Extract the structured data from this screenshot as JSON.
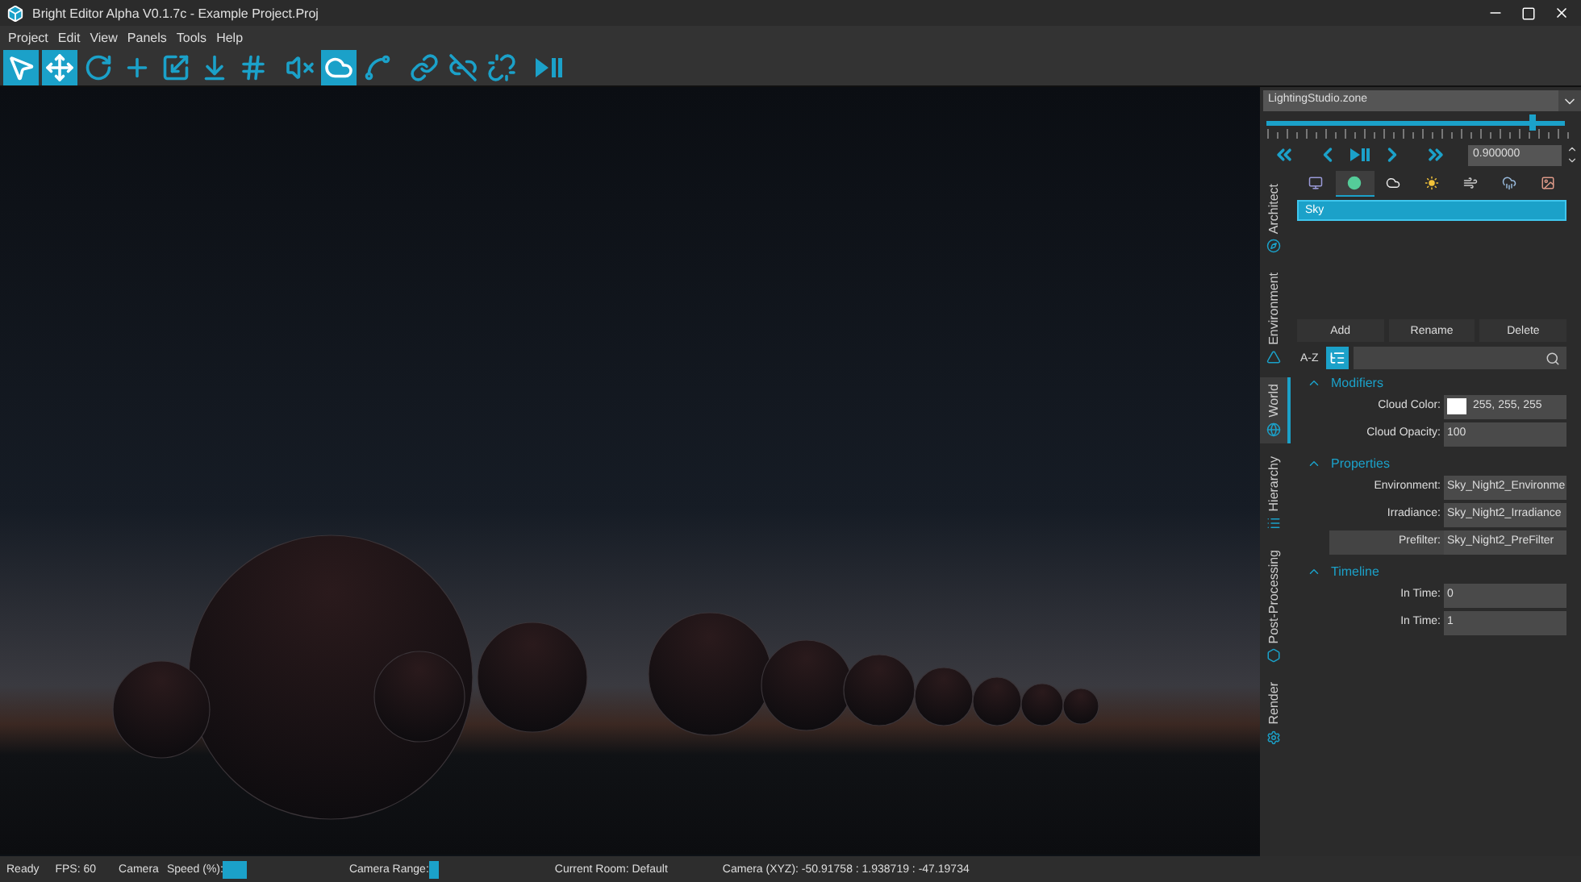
{
  "window": {
    "title": "Bright Editor Alpha V0.1.7c - Example Project.Proj"
  },
  "menu": [
    "Project",
    "Edit",
    "View",
    "Panels",
    "Tools",
    "Help"
  ],
  "toolbar": [
    {
      "kind": "pointer",
      "selected": true
    },
    {
      "kind": "move",
      "selected": true
    },
    {
      "kind": "rotate",
      "selected": false
    },
    {
      "kind": "cross",
      "selected": false
    },
    {
      "kind": "scale",
      "selected": false
    },
    {
      "kind": "download",
      "selected": false
    },
    {
      "kind": "grid",
      "selected": false
    },
    {
      "kind": "mute",
      "selected": false
    },
    {
      "kind": "cloud",
      "selected": true
    },
    {
      "kind": "path",
      "selected": false
    },
    {
      "kind": "link-add",
      "selected": false
    },
    {
      "kind": "link-remove",
      "selected": false
    },
    {
      "kind": "unlink",
      "selected": false
    },
    {
      "kind": "play-pause",
      "selected": false
    }
  ],
  "zone": {
    "value": "LightingStudio.zone"
  },
  "timeline": {
    "level": 0.89,
    "time": "0.900000"
  },
  "side_tabs": [
    {
      "label": "Architect",
      "kind": "architect",
      "selected": false
    },
    {
      "label": "Environment",
      "kind": "environment",
      "selected": false
    },
    {
      "label": "World",
      "kind": "world",
      "selected": true
    },
    {
      "label": "Hierarchy",
      "kind": "hierarchy",
      "selected": false
    },
    {
      "label": "Post-Processing",
      "kind": "post",
      "selected": false
    },
    {
      "label": "Render",
      "kind": "render",
      "selected": false
    }
  ],
  "env_tabs": [
    {
      "kind": "screen",
      "selected": false
    },
    {
      "kind": "sphere",
      "selected": true
    },
    {
      "kind": "cloud",
      "selected": false
    },
    {
      "kind": "sun",
      "selected": false
    },
    {
      "kind": "wind",
      "selected": false
    },
    {
      "kind": "rain",
      "selected": false
    },
    {
      "kind": "portrait",
      "selected": false
    }
  ],
  "items": [
    {
      "label": "Sky",
      "selected": true
    }
  ],
  "buttons": [
    "Add",
    "Rename",
    "Delete"
  ],
  "sort": {
    "label": "A-Z"
  },
  "sections": [
    {
      "title": "Modifiers",
      "expanded": true,
      "fields": [
        {
          "label": "Cloud Color:",
          "value": "255, 255, 255",
          "kind": "color",
          "highlighted": false
        },
        {
          "label": "Cloud Opacity:",
          "value": "100",
          "highlighted": false
        }
      ]
    },
    {
      "title": "Properties",
      "expanded": true,
      "fields": [
        {
          "label": "Environment:",
          "value": "Sky_Night2_Environme",
          "highlighted": false
        },
        {
          "label": "Irradiance:",
          "value": "Sky_Night2_Irradiance",
          "highlighted": false
        },
        {
          "label": "Prefilter:",
          "value": "Sky_Night2_PreFilter",
          "highlighted": true
        }
      ]
    },
    {
      "title": "Timeline",
      "expanded": true,
      "fields": [
        {
          "label": "In Time:",
          "value": "0",
          "highlighted": false
        },
        {
          "label": "In Time:",
          "value": "1",
          "highlighted": false
        }
      ]
    }
  ],
  "status_bar": {
    "ready": "Ready",
    "fps": "FPS: 60",
    "camera": "Camera",
    "speed": "Speed (%):",
    "range": "Camera Range:",
    "room": "Current Room: Default",
    "coords": "Camera (XYZ):  -50.91758 : 1.938719 : -47.19734"
  }
}
